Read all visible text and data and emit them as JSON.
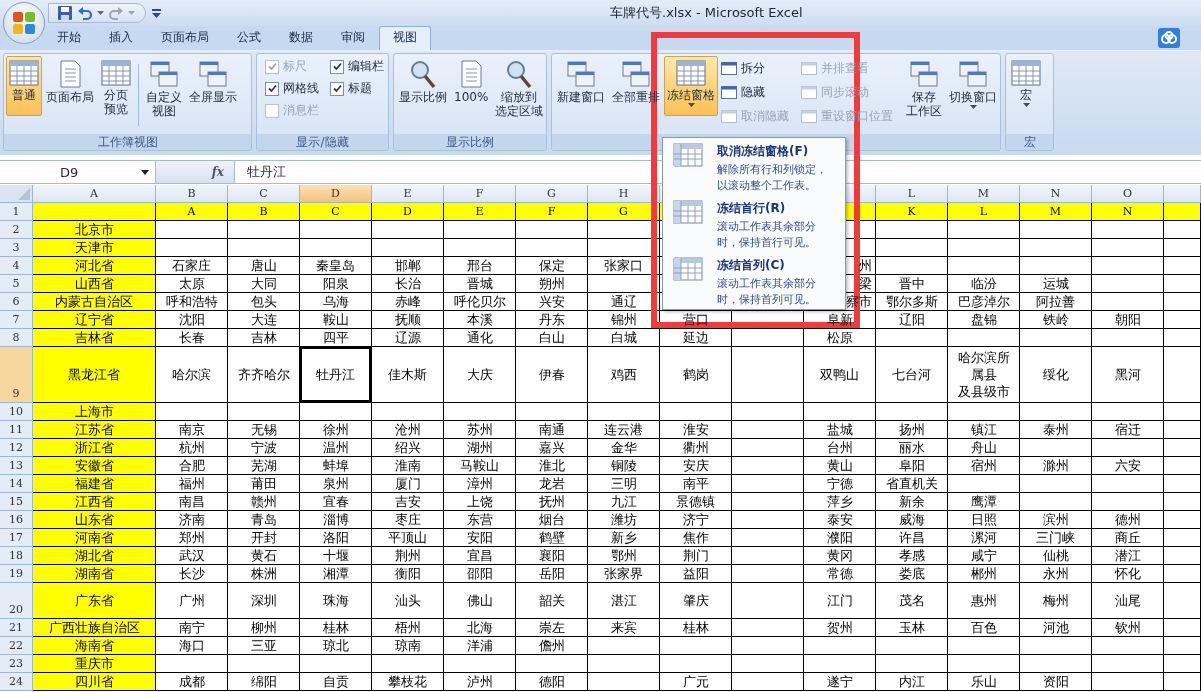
{
  "window": {
    "title": "车牌代号.xlsx - Microsoft Excel"
  },
  "tabs": [
    {
      "label": "开始",
      "selected": false
    },
    {
      "label": "插入",
      "selected": false
    },
    {
      "label": "页面布局",
      "selected": false
    },
    {
      "label": "公式",
      "selected": false
    },
    {
      "label": "数据",
      "selected": false
    },
    {
      "label": "审阅",
      "selected": false
    },
    {
      "label": "视图",
      "selected": true
    }
  ],
  "ribbon": {
    "groups": [
      {
        "label": "工作簿视图",
        "items": [
          {
            "kind": "large",
            "label": "普通",
            "selected": true
          },
          {
            "kind": "large",
            "label": "页面布局",
            "selected": false
          },
          {
            "kind": "large",
            "label": [
              "分页",
              "预览"
            ],
            "selected": false
          },
          {
            "kind": "separator"
          },
          {
            "kind": "large",
            "label": [
              "自定义",
              "视图"
            ],
            "selected": false
          },
          {
            "kind": "large",
            "label": "全屏显示",
            "selected": false
          }
        ]
      },
      {
        "label": "显示/隐藏",
        "items": [
          {
            "kind": "checks",
            "checks": [
              {
                "label": "标尺",
                "checked": true,
                "disabled": true
              },
              {
                "label": "网格线",
                "checked": true,
                "disabled": false
              },
              {
                "label": "消息栏",
                "checked": false,
                "disabled": true
              }
            ]
          },
          {
            "kind": "checks",
            "checks": [
              {
                "label": "编辑栏",
                "checked": true,
                "disabled": false
              },
              {
                "label": "标题",
                "checked": true,
                "disabled": false
              }
            ]
          }
        ]
      },
      {
        "label": "显示比例",
        "items": [
          {
            "kind": "large",
            "label": "显示比例",
            "selected": false
          },
          {
            "kind": "large",
            "label": "100%",
            "selected": false
          },
          {
            "kind": "large",
            "label": [
              "缩放到",
              "选定区域"
            ],
            "selected": false
          }
        ]
      },
      {
        "items": [
          {
            "kind": "large",
            "label": "新建窗口",
            "selected": false
          },
          {
            "kind": "large",
            "label": "全部重排",
            "selected": false
          },
          {
            "kind": "large",
            "label": "冻结窗格",
            "selected": true,
            "dropdown": true
          },
          {
            "kind": "stack",
            "items": [
              {
                "label": "拆分",
                "disabled": false
              },
              {
                "label": "隐藏",
                "disabled": false
              },
              {
                "label": "取消隐藏",
                "disabled": true
              }
            ]
          },
          {
            "kind": "separator"
          },
          {
            "kind": "stack",
            "items": [
              {
                "label": "并排查看",
                "disabled": true
              },
              {
                "label": "同步滚动",
                "disabled": true
              },
              {
                "label": "重设窗口位置",
                "disabled": true
              }
            ]
          },
          {
            "kind": "separator"
          },
          {
            "kind": "large",
            "label": [
              "保存",
              "工作区"
            ],
            "selected": false
          },
          {
            "kind": "large",
            "label": "切换窗口",
            "selected": false,
            "dropdown": true
          }
        ]
      },
      {
        "label": "宏",
        "items": [
          {
            "kind": "large",
            "label": "宏",
            "selected": false,
            "dropdown": true
          }
        ]
      }
    ]
  },
  "formula_bar": {
    "name_box": "D9",
    "function_button": "fx",
    "formula": "牡丹江"
  },
  "sheet": {
    "columns": [
      {
        "label": "A",
        "selected": false
      },
      {
        "label": "B",
        "selected": false
      },
      {
        "label": "C",
        "selected": false
      },
      {
        "label": "D",
        "selected": true
      },
      {
        "label": "E",
        "selected": false
      },
      {
        "label": "F",
        "selected": false
      },
      {
        "label": "G",
        "selected": false
      },
      {
        "label": "H",
        "selected": false
      },
      {
        "selected": false
      },
      null,
      {
        "selected": false
      },
      {
        "label": "L",
        "selected": false
      },
      {
        "label": "M",
        "selected": false
      },
      {
        "label": "N",
        "selected": false
      },
      {
        "label": "O",
        "selected": false
      },
      {
        "selected": false
      }
    ],
    "rows": [
      {
        "label": "1",
        "selected": false,
        "cells": [
          null,
          "A",
          "B",
          "C",
          "D",
          "E",
          "F",
          "G",
          null,
          null,
          null,
          "K",
          "L",
          "M",
          "N"
        ]
      },
      {
        "label": "2",
        "selected": false,
        "cells": [
          "北京市"
        ]
      },
      {
        "label": "3",
        "selected": false,
        "cells": [
          "天津市"
        ]
      },
      {
        "label": "4",
        "selected": false,
        "cells": [
          "河北省",
          "石家庄",
          "唐山",
          "秦皇岛",
          "邯郸",
          "邢台",
          "保定",
          "张家口",
          null,
          null,
          {
            "text": "州",
            "cut": true
          }
        ]
      },
      {
        "label": "5",
        "selected": false,
        "cells": [
          "山西省",
          "太原",
          "大同",
          "阳泉",
          "长治",
          "晋城",
          "朔州",
          null,
          null,
          null,
          {
            "text": "梁",
            "cut": true
          },
          "晋中",
          "临汾",
          "运城"
        ]
      },
      {
        "label": "6",
        "selected": false,
        "cells": [
          "内蒙古自治区",
          "呼和浩特",
          "包头",
          "乌海",
          "赤峰",
          "呼伦贝尔",
          "兴安",
          "通辽",
          null,
          null,
          {
            "text": "察市",
            "cut": true
          },
          "鄂尔多斯",
          "巴彦淖尔",
          "阿拉善"
        ]
      },
      {
        "label": "7",
        "selected": false,
        "cells": [
          "辽宁省",
          "沈阳",
          "大连",
          "鞍山",
          "抚顺",
          "本溪",
          "丹东",
          "锦州",
          "营口",
          null,
          "阜新",
          "辽阳",
          "盘锦",
          "铁岭",
          "朝阳"
        ]
      },
      {
        "label": "8",
        "selected": false,
        "cells": [
          "吉林省",
          "长春",
          "吉林",
          "四平",
          "辽源",
          "通化",
          "白山",
          "白城",
          "延边",
          null,
          "松原"
        ]
      },
      {
        "label": "9",
        "selected": true,
        "cells": [
          "黑龙江省",
          "哈尔滨",
          "齐齐哈尔",
          "牡丹江",
          "佳木斯",
          "大庆",
          "伊春",
          "鸡西",
          "鹤岗",
          null,
          "双鸭山",
          "七台河",
          [
            "哈尔滨所属县",
            "及县级市"
          ],
          "绥化",
          "黑河"
        ]
      },
      {
        "label": "10",
        "selected": false,
        "cells": [
          "上海市"
        ]
      },
      {
        "label": "11",
        "selected": false,
        "cells": [
          "江苏省",
          "南京",
          "无锡",
          "徐州",
          "沧州",
          "苏州",
          "南通",
          "连云港",
          "淮安",
          null,
          "盐城",
          "扬州",
          "镇江",
          "泰州",
          "宿迁"
        ]
      },
      {
        "label": "12",
        "selected": false,
        "cells": [
          "浙江省",
          "杭州",
          "宁波",
          "温州",
          "绍兴",
          "湖州",
          "嘉兴",
          "金华",
          "衢州",
          null,
          "台州",
          "丽水",
          "舟山"
        ]
      },
      {
        "label": "13",
        "selected": false,
        "cells": [
          "安徽省",
          "合肥",
          "芜湖",
          "蚌埠",
          "淮南",
          "马鞍山",
          "淮北",
          "铜陵",
          "安庆",
          null,
          "黄山",
          "阜阳",
          "宿州",
          "滁州",
          "六安"
        ]
      },
      {
        "label": "14",
        "selected": false,
        "cells": [
          "福建省",
          "福州",
          "莆田",
          "泉州",
          "厦门",
          "漳州",
          "龙岩",
          "三明",
          "南平",
          null,
          "宁德",
          "省直机关"
        ]
      },
      {
        "label": "15",
        "selected": false,
        "cells": [
          "江西省",
          "南昌",
          "赣州",
          "宜春",
          "吉安",
          "上饶",
          "抚州",
          "九江",
          "景德镇",
          null,
          "萍乡",
          "新余",
          "鹰潭"
        ]
      },
      {
        "label": "16",
        "selected": false,
        "cells": [
          "山东省",
          "济南",
          "青岛",
          "淄博",
          "枣庄",
          "东营",
          "烟台",
          "潍坊",
          "济宁",
          null,
          "泰安",
          "威海",
          "日照",
          "滨州",
          "德州"
        ]
      },
      {
        "label": "17",
        "selected": false,
        "cells": [
          "河南省",
          "郑州",
          "开封",
          "洛阳",
          "平顶山",
          "安阳",
          "鹤壁",
          "新乡",
          "焦作",
          null,
          "濮阳",
          "许昌",
          "漯河",
          "三门峡",
          "商丘"
        ]
      },
      {
        "label": "18",
        "selected": false,
        "cells": [
          "湖北省",
          "武汉",
          "黄石",
          "十堰",
          "荆州",
          "宜昌",
          "襄阳",
          "鄂州",
          "荆门",
          null,
          "黄冈",
          "孝感",
          "咸宁",
          "仙桃",
          "潜江"
        ]
      },
      {
        "label": "19",
        "selected": false,
        "cells": [
          "湖南省",
          "长沙",
          "株洲",
          "湘潭",
          "衡阳",
          "邵阳",
          "岳阳",
          "张家界",
          "益阳",
          null,
          "常德",
          "娄底",
          "郴州",
          "永州",
          "怀化"
        ]
      },
      {
        "label": "20",
        "selected": false,
        "cells": [
          "广东省",
          "广州",
          "深圳",
          "珠海",
          "汕头",
          "佛山",
          "韶关",
          "湛江",
          "肇庆",
          null,
          "江门",
          "茂名",
          "惠州",
          "梅州",
          "汕尾"
        ]
      },
      {
        "label": "21",
        "selected": false,
        "cells": [
          "广西壮族自治区",
          "南宁",
          "柳州",
          "桂林",
          "梧州",
          "北海",
          "崇左",
          "来宾",
          "桂林",
          null,
          "贺州",
          "玉林",
          "百色",
          "河池",
          "钦州"
        ]
      },
      {
        "label": "22",
        "selected": false,
        "cells": [
          "海南省",
          "海口",
          "三亚",
          "琼北",
          "琼南",
          "洋浦",
          "儋州"
        ]
      },
      {
        "label": "23",
        "selected": false,
        "cells": [
          "重庆市"
        ]
      },
      {
        "label": "24",
        "selected": false,
        "cells": [
          "四川省",
          "成都",
          "绵阳",
          "自贡",
          "攀枝花",
          "泸州",
          "德阳",
          null,
          "广元",
          null,
          "遂宁",
          "内江",
          "乐山",
          "资阳"
        ]
      }
    ]
  },
  "dropdown_menu": {
    "items": [
      {
        "title": "取消冻结窗格(F)",
        "description": "解除所有行和列锁定，以滚动整个工作表。"
      },
      {
        "title": "冻结首行(R)",
        "description": "滚动工作表其余部分时，保持首行可见。"
      },
      {
        "title": "冻结首列(C)",
        "description": "滚动工作表其余部分时，保持首列可见。"
      }
    ]
  }
}
